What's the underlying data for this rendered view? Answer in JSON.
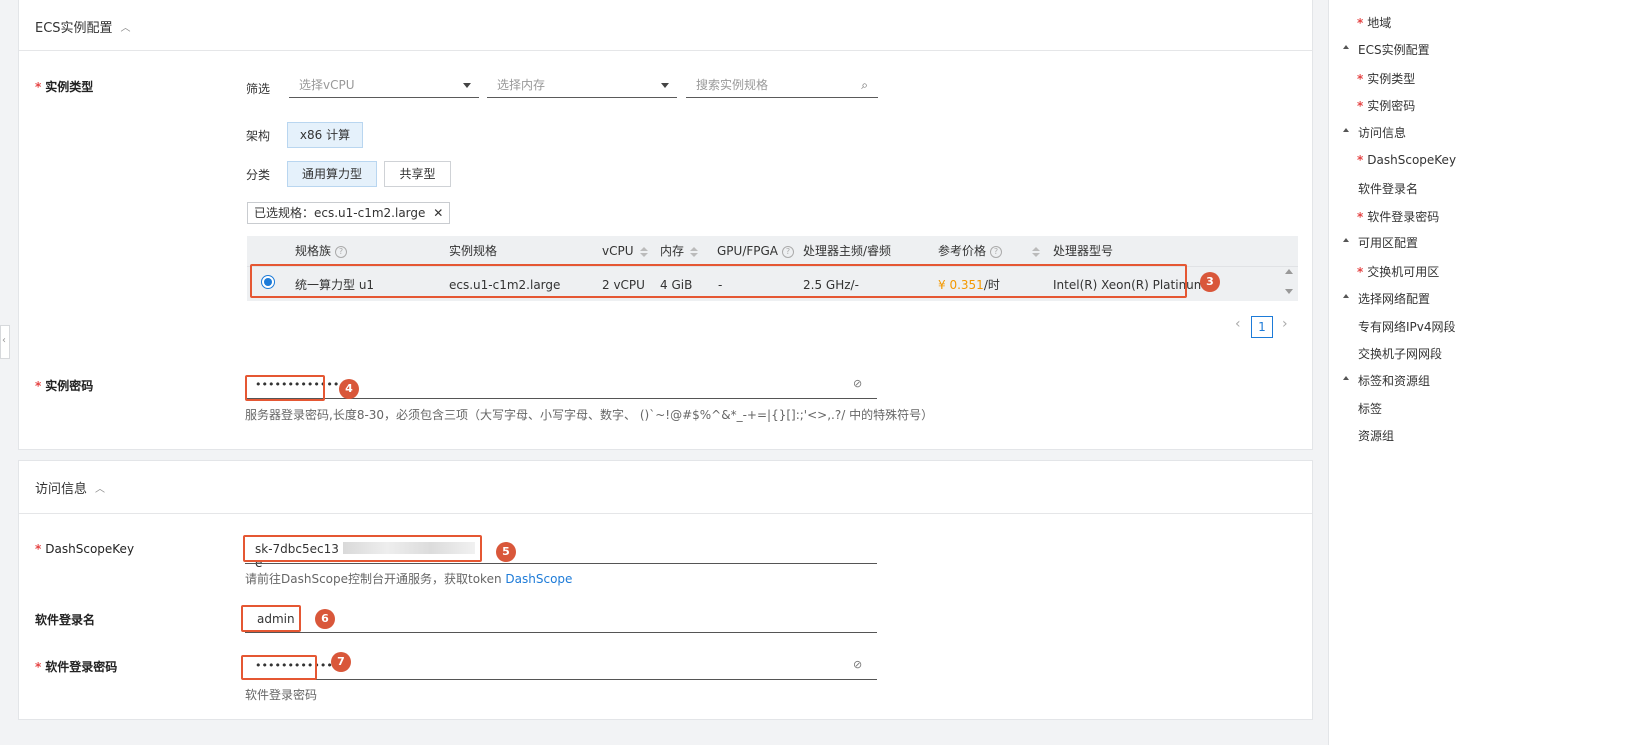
{
  "ecs_section": {
    "title": "ECS实例配置",
    "instance_type_label": "实例类型",
    "filter": {
      "label": "筛选",
      "vcpu_placeholder": "选择vCPU",
      "memory_placeholder": "选择内存",
      "search_placeholder": "搜索实例规格"
    },
    "arch": {
      "label": "架构",
      "options": [
        "x86 计算"
      ]
    },
    "category": {
      "label": "分类",
      "options": [
        "通用算力型",
        "共享型"
      ]
    },
    "selected_tag": "已选规格：ecs.u1-c1m2.large",
    "table": {
      "headers": [
        "规格族",
        "实例规格",
        "vCPU",
        "内存",
        "GPU/FPGA",
        "处理器主频/睿频",
        "参考价格",
        "处理器型号"
      ],
      "rows": [
        {
          "family": "统一算力型 u1",
          "spec": "ecs.u1-c1m2.large",
          "vcpu": "2 vCPU",
          "memory": "4 GiB",
          "gpu": "-",
          "freq": "2.5 GHz/-",
          "price": "¥ 0.351",
          "price_unit": "/时",
          "cpu_model": "Intel(R) Xeon(R) Platinum"
        }
      ]
    },
    "pager": {
      "current": "1"
    },
    "password_label": "实例密码",
    "password_value": "•••••••••••••",
    "password_hint": "服务器登录密码,长度8-30，必须包含三项（大写字母、小写字母、数字、 ()`~!@#$%^&*_-+=|{}[]:;'<>,.?/ 中的特殊符号）"
  },
  "access_section": {
    "title": "访问信息",
    "dashscope_label": "DashScopeKey",
    "dashscope_value_start": "sk-7dbc5ec13",
    "dashscope_value_end": "e",
    "dashscope_hint": "请前往DashScope控制台开通服务，获取token",
    "dashscope_link": "DashScope",
    "login_name_label": "软件登录名",
    "login_name_value": "admin",
    "login_password_label": "软件登录密码",
    "login_password_value": "••••••••••••",
    "login_password_hint": "软件登录密码"
  },
  "annotations": [
    "3",
    "4",
    "5",
    "6",
    "7"
  ],
  "sidebar": {
    "items": [
      {
        "label": "地域",
        "required": true,
        "group": false
      },
      {
        "label": "ECS实例配置",
        "required": false,
        "group": true
      },
      {
        "label": "实例类型",
        "required": true,
        "group": false
      },
      {
        "label": "实例密码",
        "required": true,
        "group": false
      },
      {
        "label": "访问信息",
        "required": false,
        "group": true
      },
      {
        "label": "DashScopeKey",
        "required": true,
        "group": false
      },
      {
        "label": "软件登录名",
        "required": false,
        "group": false
      },
      {
        "label": "软件登录密码",
        "required": true,
        "group": false
      },
      {
        "label": "可用区配置",
        "required": false,
        "group": true
      },
      {
        "label": "交换机可用区",
        "required": true,
        "group": false
      },
      {
        "label": "选择网络配置",
        "required": false,
        "group": true
      },
      {
        "label": "专有网络IPv4网段",
        "required": false,
        "group": false
      },
      {
        "label": "交换机子网网段",
        "required": false,
        "group": false
      },
      {
        "label": "标签和资源组",
        "required": false,
        "group": true
      },
      {
        "label": "标签",
        "required": false,
        "group": false
      },
      {
        "label": "资源组",
        "required": false,
        "group": false
      }
    ]
  },
  "colors": {
    "accent": "#1d7bd8",
    "required": "#e54545",
    "annotation": "#e55733",
    "price": "#f39800"
  }
}
